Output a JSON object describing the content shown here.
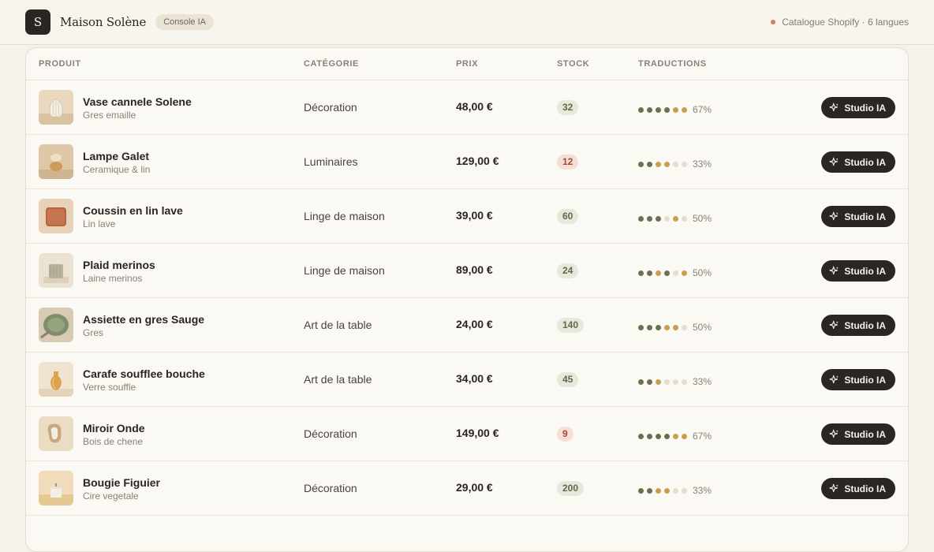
{
  "header": {
    "logo_letter": "S",
    "brand": "Maison Solène",
    "badge": "Console IA",
    "catalog": "Catalogue Shopify · 6 langues"
  },
  "columns": {
    "product": "PRODUIT",
    "category": "CATÉGORIE",
    "price": "PRIX",
    "stock": "STOCK",
    "translations": "TRADUCTIONS"
  },
  "action_label": "Studio IA",
  "rows": [
    {
      "name": "Vase cannele Solene",
      "material": "Gres emaille",
      "category": "Décoration",
      "price": "48,00 €",
      "stock": "32",
      "stock_low": false,
      "dots": [
        "g",
        "g",
        "g",
        "g",
        "y",
        "y"
      ],
      "pct": "67%"
    },
    {
      "name": "Lampe Galet",
      "material": "Ceramique & lin",
      "category": "Luminaires",
      "price": "129,00 €",
      "stock": "12",
      "stock_low": true,
      "dots": [
        "g",
        "g",
        "y",
        "y",
        "e",
        "e"
      ],
      "pct": "33%"
    },
    {
      "name": "Coussin en lin lave",
      "material": "Lin lave",
      "category": "Linge de maison",
      "price": "39,00 €",
      "stock": "60",
      "stock_low": false,
      "dots": [
        "g",
        "g",
        "g",
        "e",
        "y",
        "e"
      ],
      "pct": "50%"
    },
    {
      "name": "Plaid merinos",
      "material": "Laine merinos",
      "category": "Linge de maison",
      "price": "89,00 €",
      "stock": "24",
      "stock_low": false,
      "dots": [
        "g",
        "g",
        "y",
        "g",
        "e",
        "y"
      ],
      "pct": "50%"
    },
    {
      "name": "Assiette en gres Sauge",
      "material": "Gres",
      "category": "Art de la table",
      "price": "24,00 €",
      "stock": "140",
      "stock_low": false,
      "dots": [
        "g",
        "g",
        "g",
        "y",
        "y",
        "e"
      ],
      "pct": "50%"
    },
    {
      "name": "Carafe soufflee bouche",
      "material": "Verre souffle",
      "category": "Art de la table",
      "price": "34,00 €",
      "stock": "45",
      "stock_low": false,
      "dots": [
        "g",
        "g",
        "y",
        "e",
        "e",
        "e"
      ],
      "pct": "33%"
    },
    {
      "name": "Miroir Onde",
      "material": "Bois de chene",
      "category": "Décoration",
      "price": "149,00 €",
      "stock": "9",
      "stock_low": true,
      "dots": [
        "g",
        "g",
        "g",
        "g",
        "y",
        "y"
      ],
      "pct": "67%"
    },
    {
      "name": "Bougie Figuier",
      "material": "Cire vegetale",
      "category": "Décoration",
      "price": "29,00 €",
      "stock": "200",
      "stock_low": false,
      "dots": [
        "g",
        "g",
        "y",
        "y",
        "e",
        "e"
      ],
      "pct": "33%"
    }
  ],
  "thumb_icons": [
    "vase-thumbnail-icon",
    "lamp-thumbnail-icon",
    "cushion-thumbnail-icon",
    "throw-thumbnail-icon",
    "plate-thumbnail-icon",
    "carafe-thumbnail-icon",
    "mirror-thumbnail-icon",
    "candle-thumbnail-icon"
  ],
  "colors": {
    "dark": "#2b2622",
    "accent_green": "#6b7052",
    "accent_gold": "#c99f4e",
    "low_stock": "#a24d33"
  }
}
